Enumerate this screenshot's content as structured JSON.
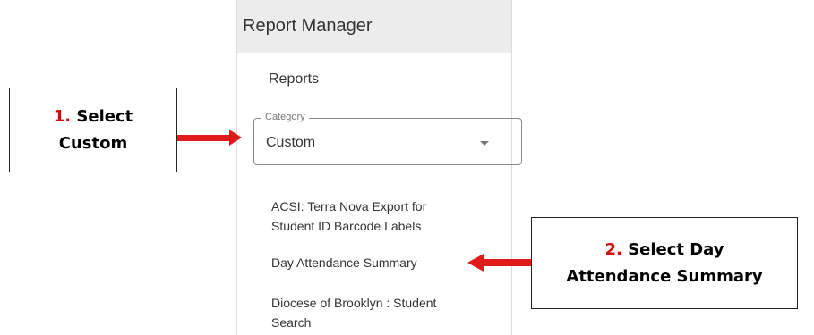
{
  "panel": {
    "title": "Report Manager",
    "section_title": "Reports",
    "category": {
      "legend": "Category",
      "value": "Custom",
      "icon": "chevron-down-icon"
    },
    "reports": [
      {
        "line1": "ACSI: Terra Nova Export for",
        "line2": "Student ID Barcode Labels"
      },
      {
        "line1": "Day Attendance Summary"
      },
      {
        "line1": "Diocese of Brooklyn : Student",
        "line2": "Search"
      }
    ]
  },
  "callouts": [
    {
      "number": "1.",
      "line1": "Select",
      "line2": "Custom"
    },
    {
      "number": "2.",
      "line1": "Select Day",
      "line2": "Attendance Summary"
    }
  ],
  "colors": {
    "arrow": "#e11b1b",
    "step_number": "#cc1111",
    "header_bg": "#ececec"
  }
}
